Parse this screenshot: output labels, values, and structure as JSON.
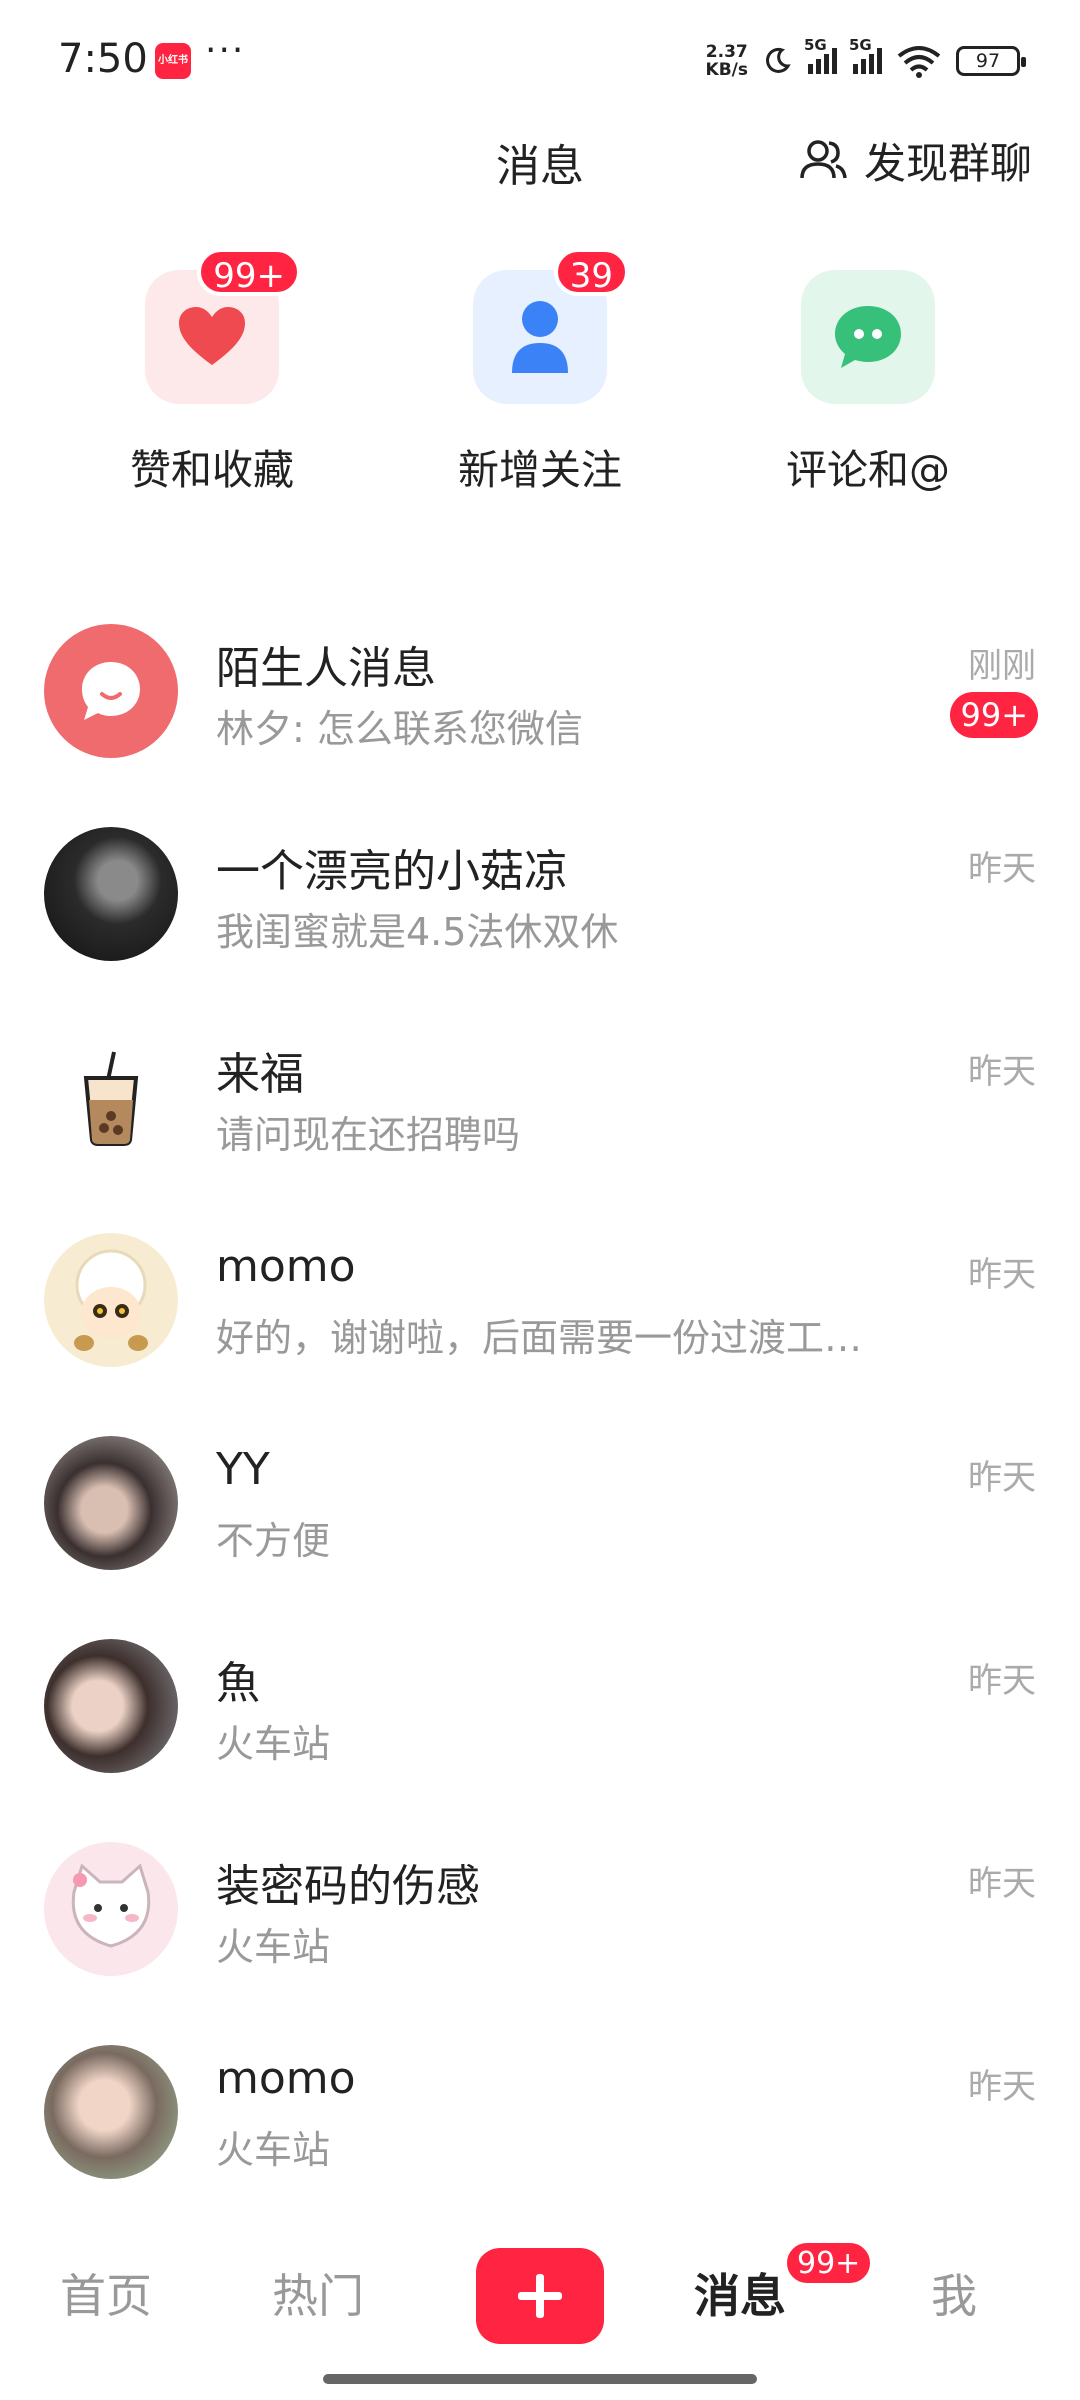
{
  "status_bar": {
    "time": "7:50",
    "app_icon_text": "小红书",
    "dots": "···",
    "net_speed_top": "2.37",
    "net_speed_bottom": "KB/s",
    "sig1_tag": "5G",
    "sig2_tag": "5G",
    "battery": "97"
  },
  "header": {
    "title": "消息",
    "discover_label": "发现群聊"
  },
  "quick_actions": [
    {
      "label": "赞和收藏",
      "badge": "99+",
      "icon": "heart-icon",
      "bg": "#fde9ea",
      "color": "#ee4a4f"
    },
    {
      "label": "新增关注",
      "badge": "39",
      "icon": "person-icon",
      "bg": "#e7f0fe",
      "color": "#3b82f6"
    },
    {
      "label": "评论和@",
      "badge": "",
      "icon": "chat-bubble-icon",
      "bg": "#e3f6ec",
      "color": "#37c07a"
    }
  ],
  "conversations": [
    {
      "name": "陌生人消息",
      "message": "林夕: 怎么联系您微信",
      "time": "刚刚",
      "badge": "99+"
    },
    {
      "name": "一个漂亮的小菇凉",
      "message": "我闺蜜就是4.5法休双休",
      "time": "昨天",
      "badge": ""
    },
    {
      "name": "来福",
      "message": "请问现在还招聘吗",
      "time": "昨天",
      "badge": ""
    },
    {
      "name": "momo",
      "message": "好的，谢谢啦，后面需要一份过渡工…",
      "time": "昨天",
      "badge": ""
    },
    {
      "name": "YY",
      "message": "不方便",
      "time": "昨天",
      "badge": ""
    },
    {
      "name": "魚",
      "message": "火车站",
      "time": "昨天",
      "badge": ""
    },
    {
      "name": "装密码的伤感",
      "message": "火车站",
      "time": "昨天",
      "badge": ""
    },
    {
      "name": "momo",
      "message": "火车站",
      "time": "昨天",
      "badge": ""
    }
  ],
  "bottom_nav": {
    "home": "首页",
    "hot": "热门",
    "messages": "消息",
    "messages_badge": "99+",
    "me": "我"
  },
  "colors": {
    "brand_red": "#ff2442"
  }
}
